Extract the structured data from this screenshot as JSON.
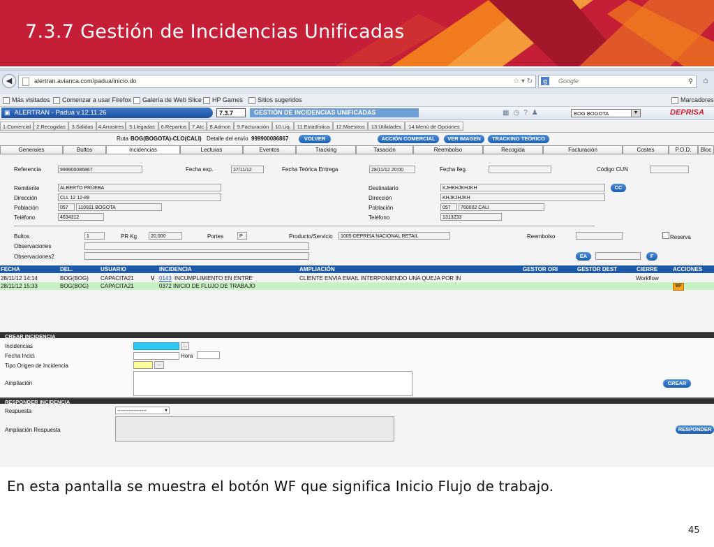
{
  "slide": {
    "title": "7.3.7 Gestión de Incidencias Unificadas",
    "caption": "En esta pantalla se muestra el botón WF que significa Inicio Flujo de trabajo.",
    "page_number": "45",
    "colors": {
      "banner_red": "#c41f36",
      "banner_orange": "#f07a1d",
      "banner_dark": "#a3172a"
    }
  },
  "browser": {
    "url": "alertran.avianca.com/padua/inicio.do",
    "search_placeholder": "Google",
    "bookmarks": [
      "Más visitados",
      "Comenzar a usar Firefox",
      "Galería de Web Slice",
      "HP Games",
      "Sitios sugeridos"
    ],
    "bookmarks_menu": "Marcadores"
  },
  "app": {
    "name": "ALERTRAN - Padua  v.12.11.26",
    "menu_code": "7.3.7",
    "menu_title": "GESTIÓN DE INCIDENCIAS UNIFICADAS",
    "office": "BOG BOGOTA",
    "brand": "DEPRISA",
    "colors": {
      "header_blue": "#1c4f9f",
      "pill_blue": "#1b5fb5",
      "grid_header": "#1e5aa8",
      "row_highlight": "#c9f2c4",
      "wf_button": "#f6a21b"
    },
    "menu_tabs": [
      "1.Comercial",
      "2.Recogidas",
      "3.Salidas",
      "4.Arrastres",
      "5.Llegadas",
      "6.Repartos",
      "7.Atc",
      "8.Admon",
      "9.Facturación",
      "10.Liq.",
      "11.Estadística",
      "12.Maestros",
      "13.Utilidades",
      "14.Menú de Opciones"
    ]
  },
  "route": {
    "label": "Ruta",
    "route": "BOG(BOGOTA)-CLO(CALI)",
    "detail_label": "Detalle del envío",
    "shipment": "999900086867",
    "buttons": {
      "volver": "VOLVER",
      "accion": "ACCIÓN COMERCIAL",
      "imagen": "VER IMAGEN",
      "tracking": "TRACKING TEÓRICO"
    }
  },
  "detail_tabs": [
    "Generales",
    "Bultos",
    "Incidencias",
    "Lecturas",
    "Eventos",
    "Tracking",
    "Tasación",
    "Reembolso",
    "Recogida",
    "Facturación",
    "Costes",
    "P.O.D.",
    "Bloc"
  ],
  "form": {
    "referencia_label": "Referencia",
    "referencia": "999900086867",
    "fecha_exp_label": "Fecha exp.",
    "fecha_exp": "27/11/12",
    "fecha_teorica_label": "Fecha Teórica Entrega",
    "fecha_teorica": "28/11/12 20:00",
    "fecha_lleg_label": "Fecha lleg.",
    "fecha_lleg": "",
    "codigo_cun_label": "Código CUN",
    "codigo_cun": "",
    "remitente_label": "Remitente",
    "remitente": "ALBERTO PRUEBA",
    "direccion_label": "Dirección",
    "direccion_rem": "CLL 12 12-89",
    "poblacion_label": "Población",
    "poblacion_rem_code": "057",
    "poblacion_rem": "110911 BOGOTA",
    "telefono_label": "Teléfono",
    "telefono_rem": "4634312",
    "destinatario_label": "Destinatario",
    "destinatario": "KJHKHJKHJKH",
    "direccion_dest": "KHJKJHJKH",
    "poblacion_dest_code": "057",
    "poblacion_dest": "760002 CALI",
    "telefono_dest": "1313233",
    "cc_label": "CC",
    "bultos_label": "Bultos",
    "bultos": "1",
    "pr_kg_label": "PR Kg",
    "pr_kg": "20,000",
    "portes_label": "Portes",
    "portes": "P",
    "producto_label": "Producto/Servicio",
    "producto": "1005-DEPRISA NACIONAL RETAIL",
    "reembolso_label": "Reembolso",
    "reembolso": "",
    "reserva_label": "Reserva",
    "observaciones_label": "Observaciones",
    "observaciones2_label": "Observaciones2",
    "ea_label": "EA",
    "f_label": "F"
  },
  "incidents": {
    "headers": [
      "FECHA",
      "DEL.",
      "USUARIO",
      "INCIDENCIA",
      "AMPLIACIÓN",
      "GESTOR ORI",
      "GESTOR DEST",
      "CIERRE",
      "ACCIONES"
    ],
    "rows": [
      {
        "fecha": "28/11/12 14:14",
        "del": "BOG(BOG)",
        "usuario": "CAPACITA21",
        "flag": "V",
        "code": "0143",
        "incidencia": "INCUMPLIMIENTO EN ENTRE",
        "ampliacion": "CLIENTE ENVIA EMAIL INTERPONIENDO UNA QUEJA POR IN",
        "cierre": "Workflow",
        "accion": ""
      },
      {
        "fecha": "28/11/12 15:33",
        "del": "BOG(BOG)",
        "usuario": "CAPACITA21",
        "flag": "",
        "code": "",
        "incidencia": "0372 INICIO DE FLUJO DE TRABAJO",
        "ampliacion": "",
        "cierre": "",
        "accion": "WF"
      }
    ]
  },
  "crear": {
    "section": "CREAR INCIDENCIA",
    "incidencias_label": "Incidencias",
    "fecha_label": "Fecha Incid.",
    "hora_label": "Hora",
    "tipo_label": "Tipo Origen de Incidencia",
    "ampliacion_label": "Ampliación",
    "lookup": "...",
    "button": "CREAR"
  },
  "responder": {
    "section": "RESPONDER INCIDENCIA",
    "respuesta_label": "Respuesta",
    "respuesta_value": "------------------",
    "ampliacion_label": "Ampliación Respuesta",
    "button": "RESPONDER"
  }
}
